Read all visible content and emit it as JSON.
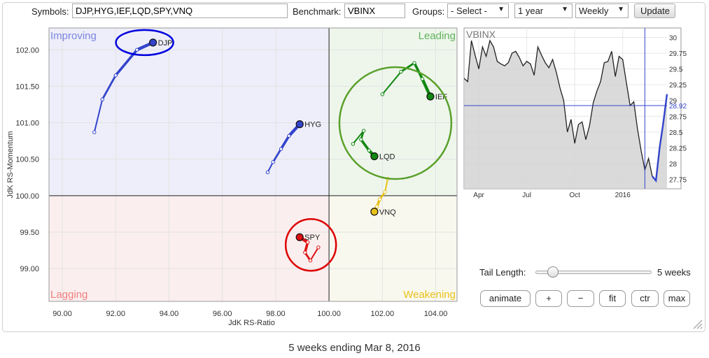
{
  "controls": {
    "symbols_label": "Symbols:",
    "symbols_value": "DJP,HYG,IEF,LQD,SPY,VNQ",
    "benchmark_label": "Benchmark:",
    "benchmark_value": "VBINX",
    "groups_label": "Groups:",
    "groups_value": "- Select -",
    "period_value": "1 year",
    "interval_value": "Weekly",
    "update_label": "Update"
  },
  "chart_data": [
    {
      "type": "scatter",
      "subtype": "relative-rotation-graph",
      "xlabel": "JdK RS-Ratio",
      "ylabel": "JdK RS-Momentum",
      "xlim": [
        89.5,
        104.8
      ],
      "ylim": [
        98.55,
        102.3
      ],
      "x_ticks": [
        "90.00",
        "92.00",
        "94.00",
        "96.00",
        "98.00",
        "100.00",
        "102.00",
        "104.00"
      ],
      "y_ticks": [
        "99.00",
        "99.50",
        "100.00",
        "100.50",
        "101.00",
        "101.50",
        "102.00"
      ],
      "quadrants": {
        "top_left": {
          "label": "Improving",
          "color": "#7b86e0"
        },
        "top_right": {
          "label": "Leading",
          "color": "#5fb35a"
        },
        "bottom_left": {
          "label": "Lagging",
          "color": "#f08080"
        },
        "bottom_right": {
          "label": "Weakening",
          "color": "#e8c21a"
        }
      },
      "series": [
        {
          "name": "DJP",
          "color": "#3344cc",
          "x": [
            91.2,
            91.5,
            92.0,
            92.8,
            93.4
          ],
          "y": [
            100.87,
            101.32,
            101.65,
            102.0,
            102.1
          ]
        },
        {
          "name": "HYG",
          "color": "#3344cc",
          "x": [
            97.7,
            97.9,
            98.2,
            98.5,
            98.9
          ],
          "y": [
            100.32,
            100.46,
            100.64,
            100.82,
            100.98
          ]
        },
        {
          "name": "IEF",
          "color": "#118811",
          "x": [
            102.0,
            102.7,
            103.2,
            103.5,
            103.8
          ],
          "y": [
            101.39,
            101.7,
            101.82,
            101.6,
            101.36
          ]
        },
        {
          "name": "LQD",
          "color": "#118811",
          "x": [
            100.9,
            101.3,
            101.2,
            101.5,
            101.7
          ],
          "y": [
            100.71,
            100.89,
            100.77,
            100.62,
            100.54
          ]
        },
        {
          "name": "SPY",
          "color": "#dd1111",
          "x": [
            99.6,
            99.3,
            99.1,
            99.2,
            98.9
          ],
          "y": [
            99.29,
            99.11,
            99.22,
            99.36,
            99.43
          ]
        },
        {
          "name": "VNQ",
          "color": "#e8c21a",
          "x": [
            102.2,
            102.1,
            101.9,
            101.8,
            101.7
          ],
          "y": [
            100.23,
            100.05,
            99.95,
            99.85,
            99.78
          ]
        }
      ],
      "highlight_circles": [
        {
          "target": "DJP",
          "color": "#0000dd"
        },
        {
          "target": "IEF",
          "color": "#5aa02a"
        },
        {
          "target": "SPY",
          "color": "#dd0000"
        }
      ],
      "grid": true
    },
    {
      "type": "line",
      "title": "VBINX",
      "x_ticks": [
        "Apr",
        "Jul",
        "Oct",
        "2016"
      ],
      "y_ticks": [
        "27.75",
        "28",
        "28.25",
        "28.5",
        "28.75",
        "29",
        "29.25",
        "29.5",
        "29.75",
        "30"
      ],
      "ylim": [
        27.6,
        30.15
      ],
      "current_value_label": "28.92",
      "values": [
        29.35,
        29.3,
        29.95,
        29.72,
        29.5,
        29.85,
        29.7,
        29.95,
        29.85,
        29.62,
        29.58,
        29.55,
        29.6,
        29.75,
        29.78,
        29.68,
        29.55,
        29.62,
        29.58,
        29.4,
        29.85,
        29.72,
        29.6,
        29.52,
        29.65,
        29.45,
        29.2,
        29.0,
        28.5,
        28.7,
        28.32,
        28.62,
        28.66,
        28.38,
        28.6,
        28.96,
        29.15,
        29.3,
        29.6,
        29.62,
        29.78,
        29.38,
        29.7,
        29.65,
        29.28,
        28.92,
        28.98,
        28.55,
        28.2,
        27.9,
        28.08,
        27.8,
        27.73,
        28.25,
        28.65,
        29.1
      ],
      "tail_start_index": 51,
      "crosshair_value": 28.92,
      "line_color": "#222222",
      "tail_color": "#3344cc",
      "fill_color": "#d3d3d3"
    }
  ],
  "tail": {
    "label": "Tail Length:",
    "value_fraction": 0.11,
    "value_text": "5 weeks"
  },
  "buttons": {
    "animate": "animate",
    "plus": "+",
    "minus": "−",
    "fit": "fit",
    "ctr": "ctr",
    "max": "max"
  },
  "caption": "5 weeks ending Mar 8, 2016"
}
